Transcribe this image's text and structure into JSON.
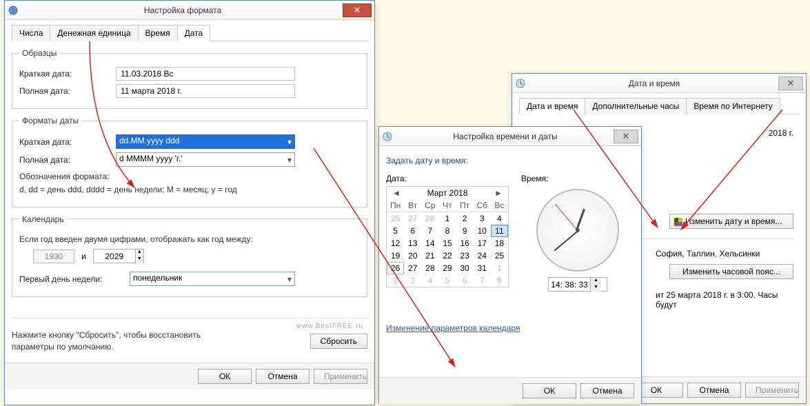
{
  "format_dialog": {
    "title": "Настройка формата",
    "tabs": [
      "Числа",
      "Денежная единица",
      "Время",
      "Дата"
    ],
    "active_tab": 3,
    "samples": {
      "legend": "Образцы",
      "short_label": "Краткая дата:",
      "short_value": "11.03.2018 Вс",
      "long_label": "Полная дата:",
      "long_value": "11 марта 2018 г."
    },
    "formats": {
      "legend": "Форматы даты",
      "short_label": "Краткая дата:",
      "short_value": "dd.MM.yyyy ddd",
      "long_label": "Полная дата:",
      "long_value": "d MMMM yyyy 'г.'",
      "hint_label": "Обозначения формата:",
      "hint_text": "d, dd = день  ddd, dddd = день недели;  М = месяц;  у = год"
    },
    "calendar": {
      "legend": "Календарь",
      "two_digit_label": "Если год введен двумя цифрами, отображать как год между:",
      "year_from": "1930",
      "and": "и",
      "year_to": "2029",
      "first_day_label": "Первый день недели:",
      "first_day_value": "понедельник"
    },
    "reset_note": "Нажмите кнопку \"Сбросить\", чтобы восстановить параметры по умолчанию.",
    "reset_btn": "Сбросить",
    "ok": "ОК",
    "cancel": "Отмена",
    "apply": "Применить"
  },
  "datetime_sheet": {
    "title": "Дата и время",
    "tabs": [
      "Дата и время",
      "Дополнительные часы",
      "Время по Интернету"
    ],
    "active_tab": 0,
    "year_text": "2018 г.",
    "change_btn": "Изменить дату и время...",
    "tz_text": "София, Таллин, Хельсинки",
    "change_tz_btn": "Изменить часовой пояс...",
    "dst_text": "ит 25 марта 2018 г. в 3:00. Часы будут",
    "ok": "ОК",
    "cancel": "Отмена",
    "apply": "Применить"
  },
  "set_datetime": {
    "title": "Настройка времени и даты",
    "heading": "Задать дату и время:",
    "date_label": "Дата:",
    "time_label": "Время:",
    "month": "Март 2018",
    "dow": [
      "Пн",
      "Вт",
      "Ср",
      "Чт",
      "Пт",
      "Сб",
      "Вс"
    ],
    "days": [
      {
        "n": 26,
        "out": true
      },
      {
        "n": 27,
        "out": true
      },
      {
        "n": 28,
        "out": true
      },
      {
        "n": 1
      },
      {
        "n": 2
      },
      {
        "n": 3
      },
      {
        "n": 4
      },
      {
        "n": 5
      },
      {
        "n": 6
      },
      {
        "n": 7
      },
      {
        "n": 8
      },
      {
        "n": 9
      },
      {
        "n": 10
      },
      {
        "n": 11,
        "sel": true
      },
      {
        "n": 12
      },
      {
        "n": 13
      },
      {
        "n": 14
      },
      {
        "n": 15
      },
      {
        "n": 16
      },
      {
        "n": 17
      },
      {
        "n": 18
      },
      {
        "n": 19
      },
      {
        "n": 20
      },
      {
        "n": 21
      },
      {
        "n": 22
      },
      {
        "n": 23
      },
      {
        "n": 24
      },
      {
        "n": 25
      },
      {
        "n": 26,
        "hi": true
      },
      {
        "n": 27
      },
      {
        "n": 28
      },
      {
        "n": 29
      },
      {
        "n": 30
      },
      {
        "n": 31
      },
      {
        "n": 1,
        "out": true
      },
      {
        "n": 2,
        "out": true
      },
      {
        "n": 3,
        "out": true
      },
      {
        "n": 4,
        "out": true
      },
      {
        "n": 5,
        "out": true
      },
      {
        "n": 6,
        "out": true
      },
      {
        "n": 7,
        "out": true
      },
      {
        "n": 8,
        "out": true
      }
    ],
    "time_value": "14: 38: 33",
    "link": "Изменение параметров календаря",
    "ok": "ОК",
    "cancel": "Отмена"
  },
  "watermark": "www.BestFREE.ru"
}
